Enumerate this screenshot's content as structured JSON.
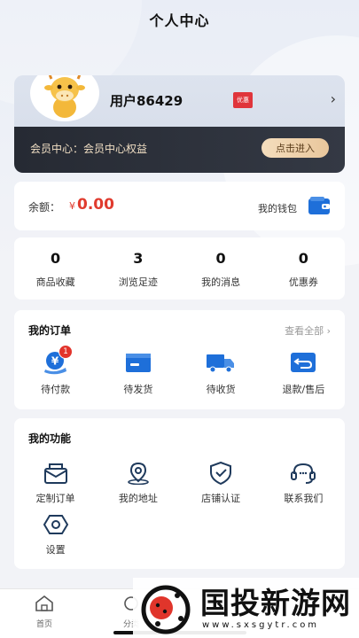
{
  "page": {
    "title": "个人中心"
  },
  "profile": {
    "username": "用户86429",
    "vip_badge": "优惠",
    "member_text": "会员中心：会员中心权益",
    "member_button": "点击进入"
  },
  "balance": {
    "label": "余额：",
    "currency": "¥",
    "value": "0.00",
    "wallet_label": "我的钱包"
  },
  "stats": [
    {
      "value": "0",
      "label": "商品收藏"
    },
    {
      "value": "3",
      "label": "浏览足迹"
    },
    {
      "value": "0",
      "label": "我的消息"
    },
    {
      "value": "0",
      "label": "优惠券"
    }
  ],
  "orders": {
    "title": "我的订单",
    "see_all": "查看全部 ›",
    "items": [
      {
        "label": "待付款",
        "icon": "payment-icon",
        "badge": "1"
      },
      {
        "label": "待发货",
        "icon": "package-icon"
      },
      {
        "label": "待收货",
        "icon": "truck-icon"
      },
      {
        "label": "退款/售后",
        "icon": "refund-icon"
      }
    ]
  },
  "functions": {
    "title": "我的功能",
    "items": [
      {
        "label": "定制订单",
        "icon": "custom-order-icon"
      },
      {
        "label": "我的地址",
        "icon": "location-icon"
      },
      {
        "label": "店铺认证",
        "icon": "shield-check-icon"
      },
      {
        "label": "联系我们",
        "icon": "headset-icon"
      },
      {
        "label": "设置",
        "icon": "settings-icon"
      }
    ]
  },
  "tabbar": {
    "home_label": "首页",
    "second_label": "分类"
  },
  "watermark": {
    "title": "国投新游网",
    "url": "www.sxsgytr.com"
  },
  "colors": {
    "accent_red": "#e03b2e",
    "icon_blue": "#1e6fd9",
    "member_gold": "#f1dfc4"
  }
}
